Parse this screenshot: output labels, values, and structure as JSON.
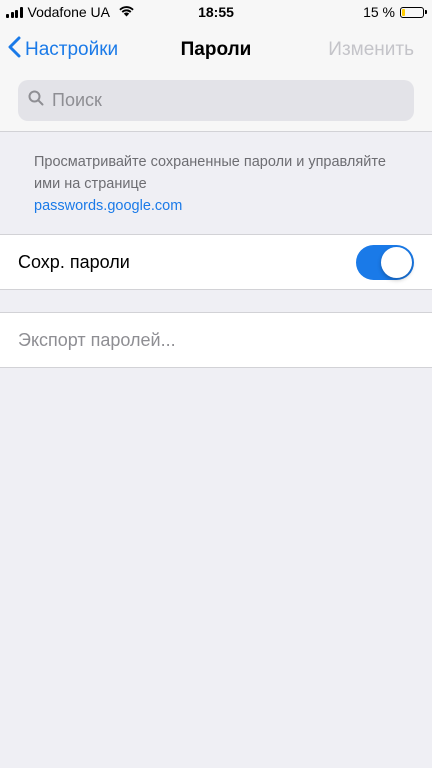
{
  "status_bar": {
    "carrier": "Vodafone UA",
    "time": "18:55",
    "battery_percent": "15 %",
    "battery_level": 0.15
  },
  "nav": {
    "back_label": "Настройки",
    "title": "Пароли",
    "edit_label": "Изменить"
  },
  "search": {
    "placeholder": "Поиск"
  },
  "info": {
    "text": "Просматривайте сохраненные пароли и управляйте ими на странице",
    "link": "passwords.google.com"
  },
  "settings": {
    "save_passwords_label": "Сохр. пароли",
    "save_passwords_on": true,
    "export_label": "Экспорт паролей..."
  },
  "colors": {
    "accent": "#1a7ae8",
    "background": "#efeff4",
    "disabled": "#c4c4c9"
  }
}
